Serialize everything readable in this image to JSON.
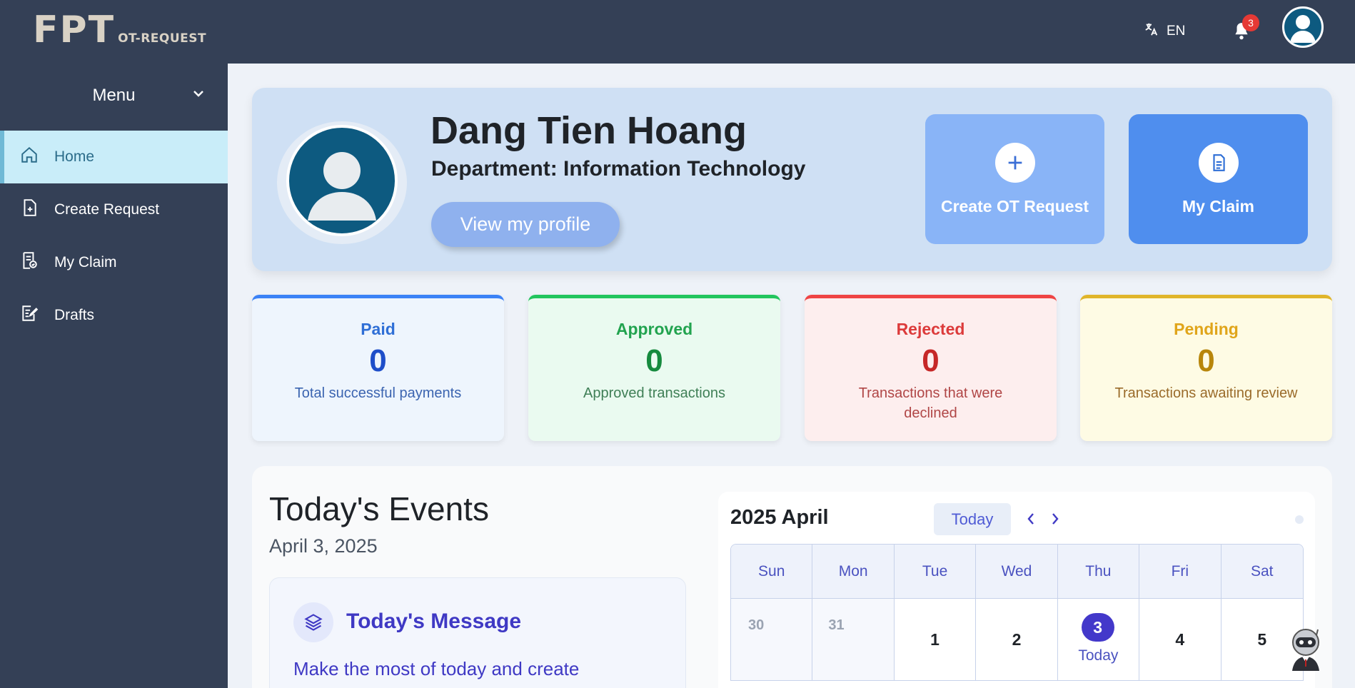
{
  "header": {
    "logo_main": "FPT",
    "logo_sub": "OT-REQUEST",
    "language": "EN",
    "notification_count": "3"
  },
  "sidebar": {
    "menu_label": "Menu",
    "items": [
      {
        "label": "Home",
        "icon": "home-icon",
        "active": true
      },
      {
        "label": "Create Request",
        "icon": "file-plus-icon"
      },
      {
        "label": "My Claim",
        "icon": "claim-icon"
      },
      {
        "label": "Drafts",
        "icon": "drafts-icon"
      }
    ]
  },
  "profile": {
    "name": "Dang Tien Hoang",
    "department": "Department: Information Technology",
    "view_profile_label": "View my profile"
  },
  "actions": {
    "create_label": "Create OT Request",
    "claim_label": "My Claim"
  },
  "stats": {
    "paid": {
      "title": "Paid",
      "value": "0",
      "desc": "Total successful payments"
    },
    "approved": {
      "title": "Approved",
      "value": "0",
      "desc": "Approved transactions"
    },
    "rejected": {
      "title": "Rejected",
      "value": "0",
      "desc": "Transactions that were declined"
    },
    "pending": {
      "title": "Pending",
      "value": "0",
      "desc": "Transactions awaiting review"
    }
  },
  "events": {
    "title": "Today's Events",
    "date": "April 3, 2025",
    "message_title": "Today's Message",
    "message_text": "Make the most of today and create"
  },
  "calendar": {
    "title": "2025 April",
    "today_button": "Today",
    "weekdays": [
      "Sun",
      "Mon",
      "Tue",
      "Wed",
      "Thu",
      "Fri",
      "Sat"
    ],
    "days": [
      "30",
      "31",
      "1",
      "2",
      "3",
      "4",
      "5"
    ],
    "today_label": "Today"
  },
  "colors": {
    "topbar": "#344056",
    "active_nav": "#c9edf9",
    "accent": "#4338ca"
  }
}
